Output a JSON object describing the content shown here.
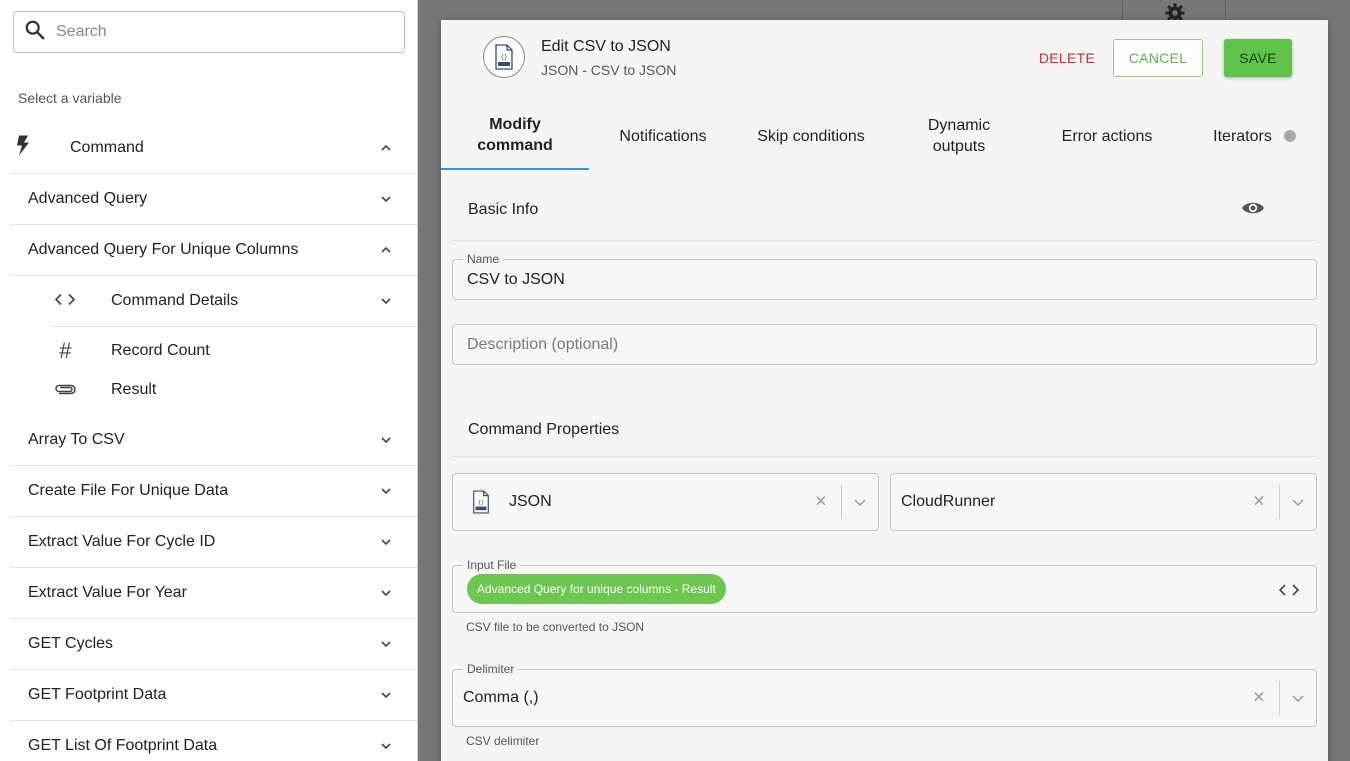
{
  "left_panel": {
    "search": {
      "placeholder": "Search"
    },
    "select_label": "Select a variable",
    "command_group": "Command",
    "items_top": [
      {
        "label": "Advanced Query",
        "expanded": false
      },
      {
        "label": "Advanced Query For Unique Columns",
        "expanded": true
      }
    ],
    "children": [
      {
        "label": "Command Details",
        "icon": "code-brackets-icon",
        "expandable": true
      },
      {
        "label": "Record Count",
        "icon": "hash-icon",
        "expandable": false
      },
      {
        "label": "Result",
        "icon": "paperclip-icon",
        "expandable": false
      }
    ],
    "items_bottom": [
      {
        "label": "Array To CSV"
      },
      {
        "label": "Create File For Unique Data"
      },
      {
        "label": "Extract Value For Cycle ID"
      },
      {
        "label": "Extract Value For Year"
      },
      {
        "label": "GET Cycles"
      },
      {
        "label": "GET Footprint Data"
      },
      {
        "label": "GET List Of Footprint Data"
      }
    ]
  },
  "modal": {
    "title": "Edit CSV to JSON",
    "subtitle": "JSON - CSV to JSON",
    "actions": {
      "delete": "DELETE",
      "cancel": "CANCEL",
      "save": "SAVE"
    },
    "tabs": [
      {
        "label": "Modify command",
        "active": true
      },
      {
        "label": "Notifications"
      },
      {
        "label": "Skip conditions"
      },
      {
        "label": "Dynamic outputs"
      },
      {
        "label": "Error actions"
      },
      {
        "label": "Iterators"
      }
    ],
    "basic_info": {
      "title": "Basic Info",
      "name_label": "Name",
      "name_value": "CSV to JSON",
      "description_placeholder": "Description (optional)"
    },
    "command_properties": {
      "title": "Command Properties",
      "connector": "JSON",
      "runner": "CloudRunner",
      "input_file_label": "Input File",
      "input_file_chip": "Advanced Query for unique columns - Result",
      "input_file_helper": "CSV file to be converted to JSON",
      "delimiter_label": "Delimiter",
      "delimiter_value": "Comma (,)",
      "delimiter_helper": "CSV delimiter"
    }
  },
  "colors": {
    "accent_green": "#5fc44a",
    "delete_red": "#d12b2b",
    "tab_underline": "#3f8ed8",
    "chip_green": "#6cc64f"
  }
}
